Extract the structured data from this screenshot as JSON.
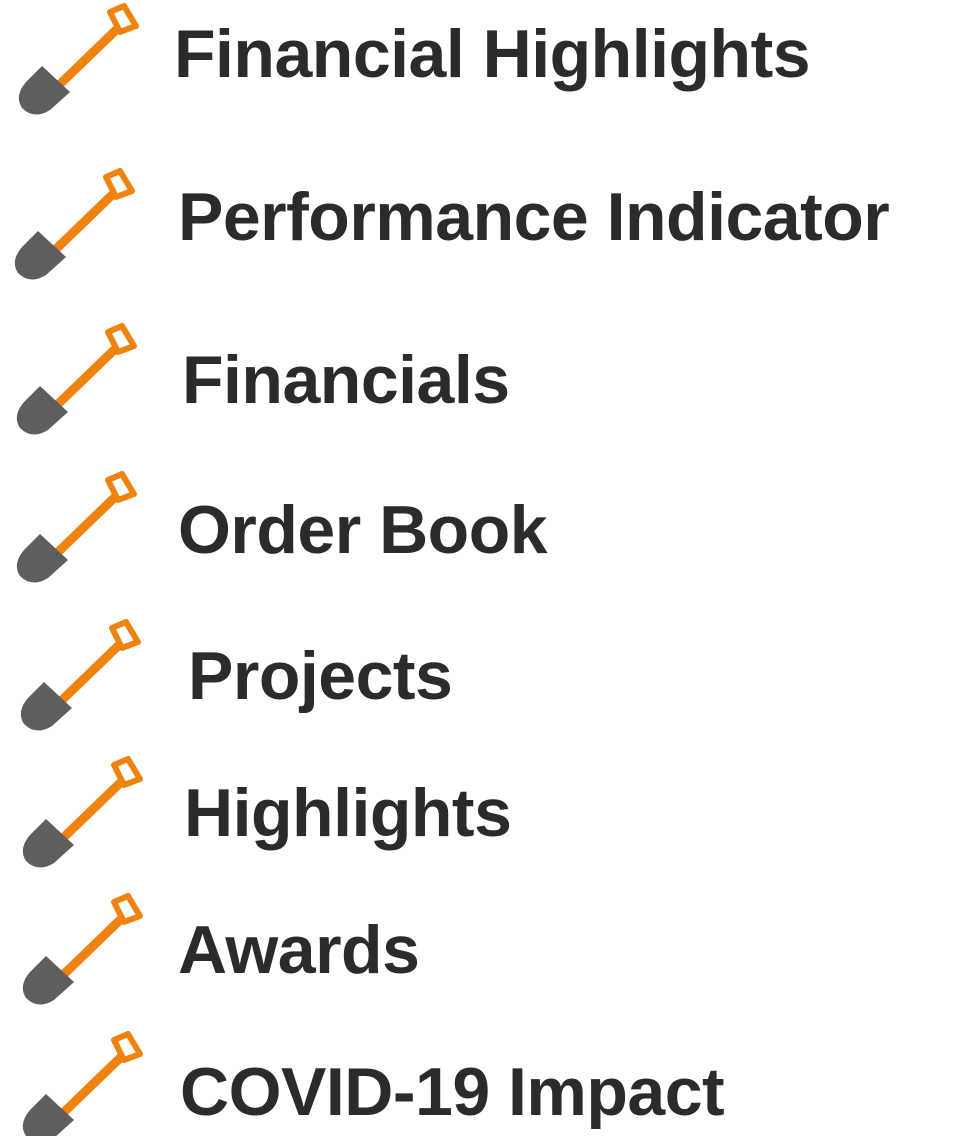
{
  "menu": {
    "items": [
      {
        "label": "Financial Highlights",
        "icon": "shovel-icon"
      },
      {
        "label": "Performance Indicator",
        "icon": "shovel-icon"
      },
      {
        "label": "Financials",
        "icon": "shovel-icon"
      },
      {
        "label": "Order Book",
        "icon": "shovel-icon"
      },
      {
        "label": "Projects",
        "icon": "shovel-icon"
      },
      {
        "label": "Highlights",
        "icon": "shovel-icon"
      },
      {
        "label": "Awards",
        "icon": "shovel-icon"
      },
      {
        "label": "COVID-19 Impact",
        "icon": "shovel-icon"
      }
    ]
  },
  "colors": {
    "handle": "#F0820F",
    "blade": "#5E5E5E",
    "text": "#2B2B2B"
  }
}
